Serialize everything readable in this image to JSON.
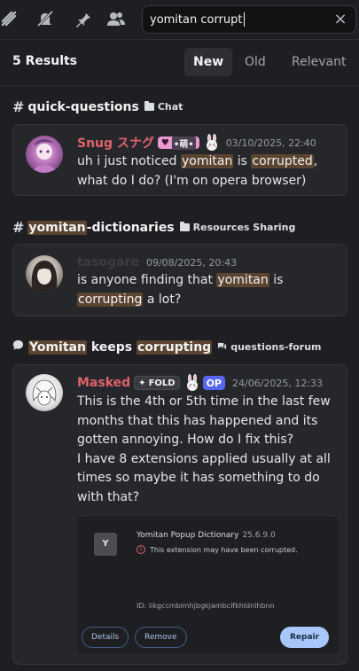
{
  "toolbar": {
    "icons": [
      "threads-icon",
      "notifications-off-icon",
      "pin-icon",
      "members-icon"
    ]
  },
  "search": {
    "value": "yomitan corrupt"
  },
  "results": {
    "count_label": "5 Results",
    "sort_options": [
      "New",
      "Old",
      "Relevant"
    ],
    "active_sort": "New"
  },
  "groups": [
    {
      "channel": "quick-questions",
      "category": "Chat",
      "message": {
        "author": "Snug スナグ",
        "author_color": "#e0636b",
        "tag": "•萌•",
        "timestamp": "03/10/2025, 22:40",
        "text": [
          "uh i just noticed ",
          "yomitan",
          " is ",
          "corrupted",
          ",\nwhat do I do? (I'm on opera browser)"
        ]
      }
    },
    {
      "channel_prefix": "yomitan",
      "channel_suffix": "-dictionaries",
      "category": "Resources Sharing",
      "message": {
        "author": "tasogare",
        "author_color": "#3b3d42",
        "timestamp": "09/08/2025, 20:43",
        "text": [
          "is anyone finding that ",
          "yomitan",
          " is\n",
          "corrupting",
          " a lot?"
        ]
      }
    },
    {
      "thread_title": [
        "Yomitan",
        " keeps ",
        "corrupting"
      ],
      "forum": "questions-forum",
      "message": {
        "author": "Masked",
        "author_color": "#e0636b",
        "tag": "FOLD",
        "op_badge": "OP",
        "timestamp": "24/06/2025, 12:33",
        "text": "This is the 4th or 5th time in the last few months that this has happened and its gotten annoying. How do I fix this?\nI have 8 extensions applied usually at all times so maybe it has something to do with that?",
        "attachment": {
          "icon_letter": "Y",
          "name": "Yomitan Popup Dictionary",
          "version": "25.6.9.0",
          "warning": "This extension may have been corrupted.",
          "id_text": "ID: likgccmbimhjbgkjambclfkhldnlhbnn",
          "buttons": [
            "Details",
            "Remove",
            "Repair"
          ]
        }
      }
    }
  ]
}
